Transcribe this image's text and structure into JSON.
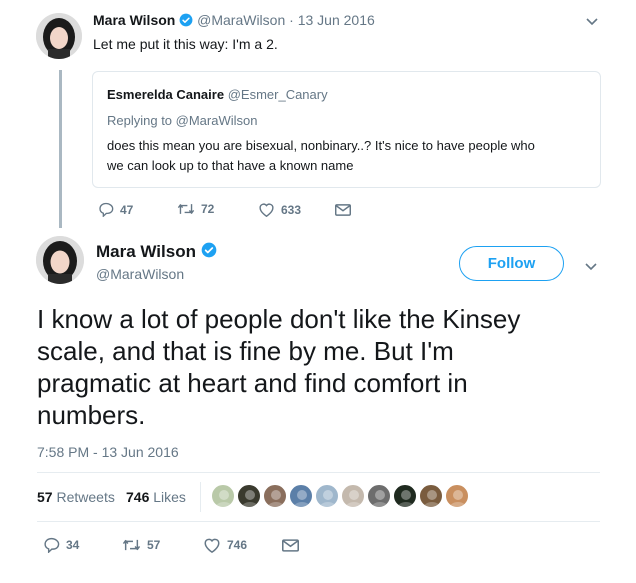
{
  "tweet1": {
    "name": "Mara Wilson",
    "handle": "@MaraWilson",
    "separator": "·",
    "date": "13 Jun 2016",
    "text": "Let me put it this way: I'm a 2."
  },
  "quoted": {
    "name": "Esmerelda Canaire",
    "handle": "@Esmer_Canary",
    "replying": "Replying to @MaraWilson",
    "text_line1": "does this mean you are bisexual, nonbinary..? It's nice to have people who",
    "text_line2": "we can look up to that have a known name"
  },
  "tweet1_actions": {
    "replies": "47",
    "retweets": "72",
    "likes": "633"
  },
  "tweet2": {
    "name": "Mara Wilson",
    "handle": "@MaraWilson",
    "follow_label": "Follow",
    "text_line1": "I know a lot of people don't like the Kinsey",
    "text_line2": "scale, and that is fine by me. But I'm",
    "text_line3": "pragmatic at heart and find comfort in",
    "text_line4": "numbers.",
    "timestamp": "7:58 PM - 13 Jun 2016"
  },
  "stats": {
    "retweets_count": "57",
    "retweets_label": "Retweets",
    "likes_count": "746",
    "likes_label": "Likes",
    "liker_colors": [
      "#b9c9a8",
      "#3a3a2e",
      "#8a6e5c",
      "#5b7fa8",
      "#9fb7cc",
      "#c4b9ad",
      "#6d6d6d",
      "#1f2a1f",
      "#7a5c3e",
      "#c98f5f"
    ]
  },
  "tweet2_actions": {
    "replies": "34",
    "retweets": "57",
    "likes": "746"
  },
  "colors": {
    "accent": "#1da1f2",
    "muted": "#657786",
    "verified": "#1da1f2"
  }
}
